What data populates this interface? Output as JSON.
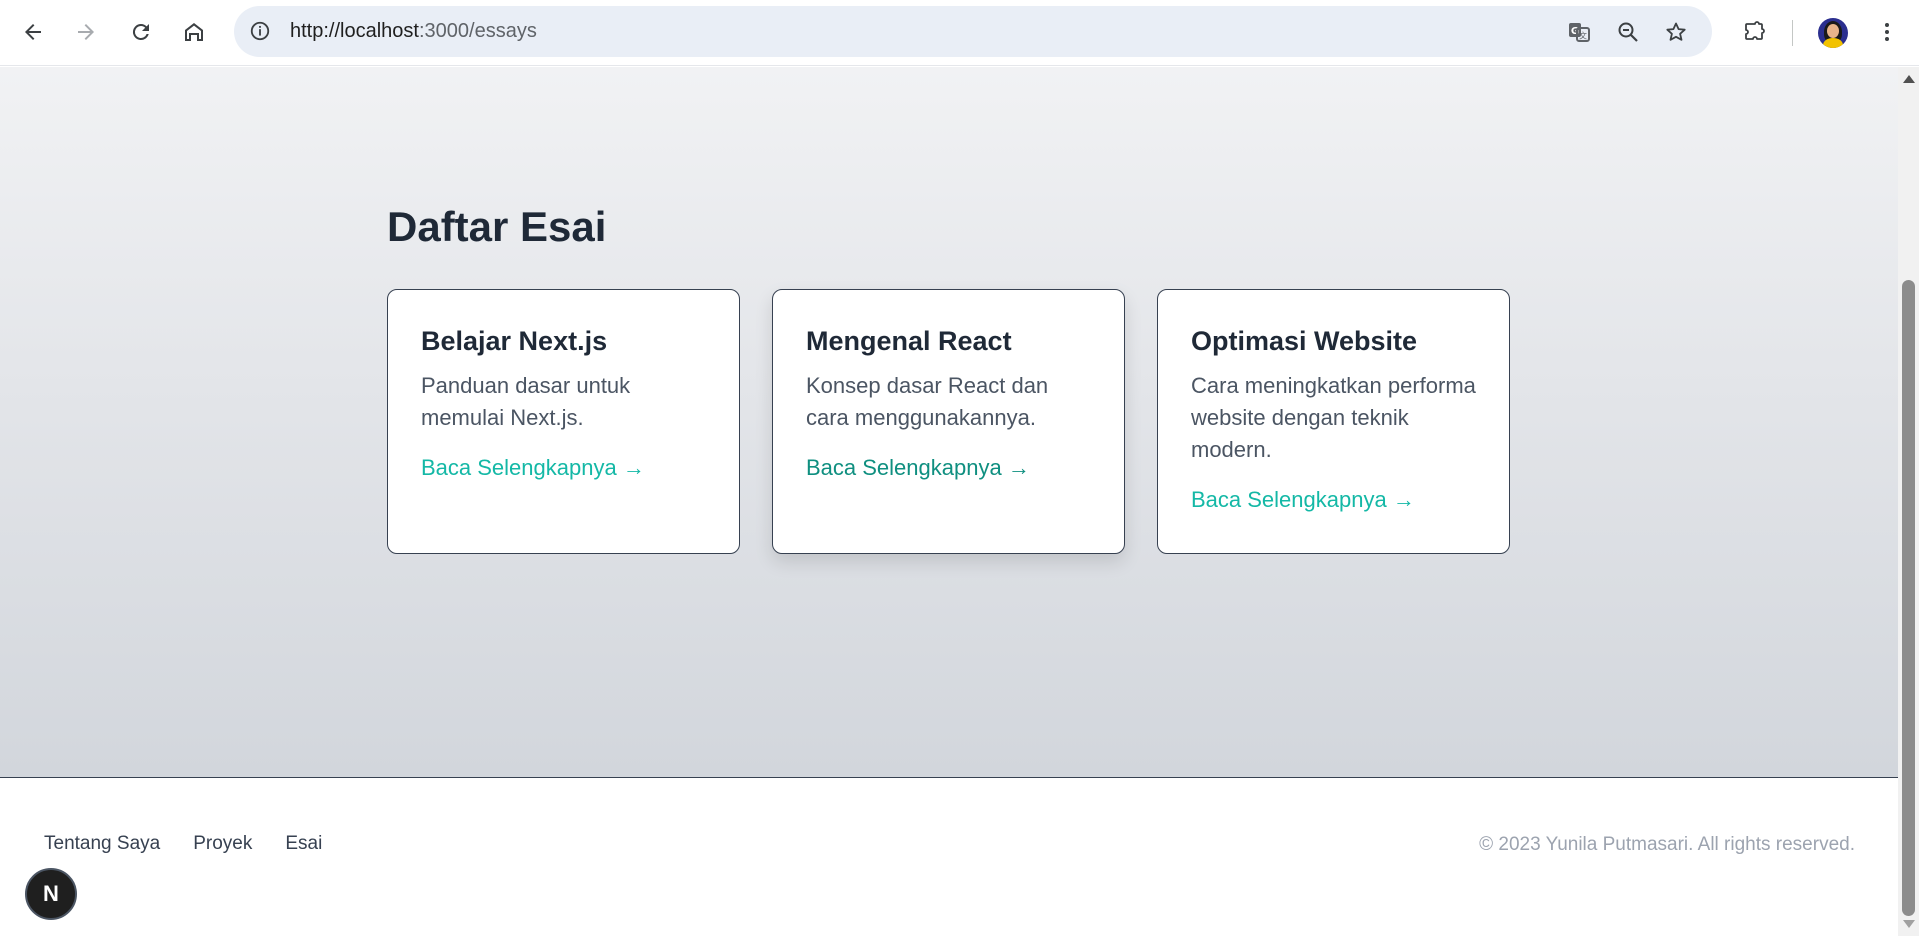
{
  "browser": {
    "url_host": "http://localhost",
    "url_path": ":3000/essays",
    "icons": {
      "back": "arrow-left-icon",
      "forward": "arrow-right-icon",
      "reload": "reload-icon",
      "home": "home-icon",
      "site_info": "info-icon",
      "translate": "translate-icon",
      "zoom": "zoom-out-icon",
      "bookmark": "star-icon",
      "extensions": "puzzle-icon",
      "profile": "avatar",
      "menu": "kebab-menu-icon"
    }
  },
  "page": {
    "title": "Daftar Esai",
    "essays": [
      {
        "title": "Belajar Next.js",
        "description": "Panduan dasar untuk memulai Next.js.",
        "link": "Baca Selengkapnya →"
      },
      {
        "title": "Mengenal React",
        "description": "Konsep dasar React dan cara menggunakannya.",
        "link": "Baca Selengkapnya →"
      },
      {
        "title": "Optimasi Website",
        "description": "Cara meningkatkan performa website dengan teknik modern.",
        "link": "Baca Selengkapnya →"
      }
    ]
  },
  "footer": {
    "nav": [
      "Tentang Saya",
      "Proyek",
      "Esai"
    ],
    "copyright": "© 2023 Yunila Putmasari. All rights reserved."
  },
  "dev_badge": "N",
  "colors": {
    "accent": "#14b8a6",
    "text_dark": "#1f2937",
    "text_muted": "#4b5563"
  }
}
